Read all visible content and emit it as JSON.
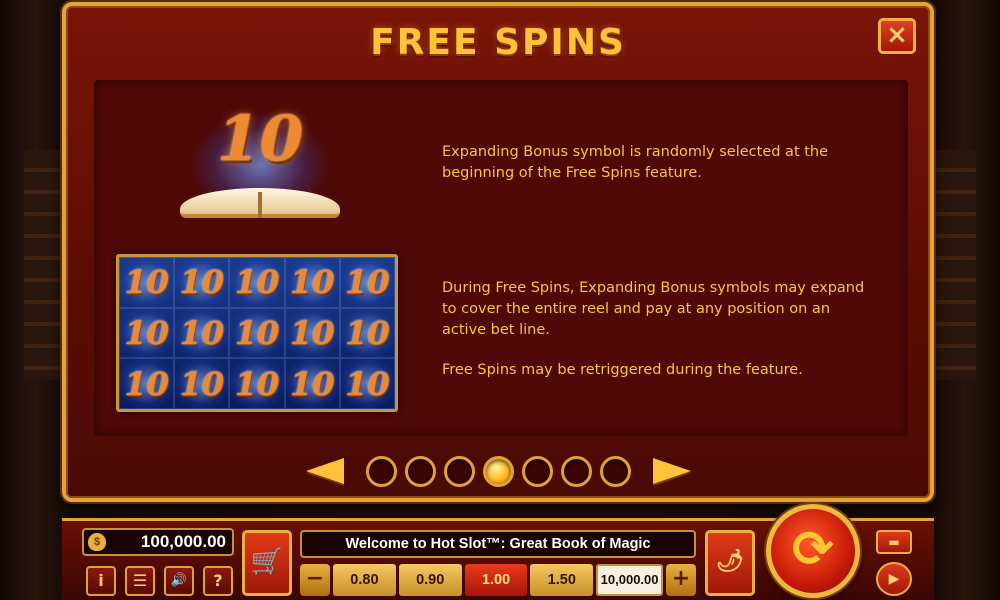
{
  "screen": {
    "title": "FREE SPINS",
    "close_icon": "×"
  },
  "feature": {
    "book_symbol_number": "10",
    "reel_symbol": "10",
    "paragraph1": "Expanding Bonus symbol is randomly selected at the beginning of the Free Spins feature.",
    "paragraph2": "During Free Spins, Expanding Bonus symbols may expand to cover the entire reel and pay at any position on an active bet line.",
    "paragraph3": "Free Spins may be retriggered during the feature."
  },
  "pager": {
    "total_pages": 7,
    "current_page": 4
  },
  "bottom_bar": {
    "balance": "100,000.00",
    "welcome": "Welcome to Hot Slot™: Great Book of Magic",
    "bet_options": [
      "0.80",
      "0.90",
      "1.00",
      "1.50"
    ],
    "selected_bet": "1.00",
    "total_bet": "10,000.00",
    "minus": "−",
    "plus": "+",
    "info": "i",
    "menu": "☰",
    "sound": "🔊",
    "help": "?",
    "cart": "🛒",
    "hot": "🌶",
    "spin": "⟳",
    "autoplay": "▬",
    "play": "▶"
  },
  "colors": {
    "accent_gold": "#ffc23a",
    "panel_red": "#7a1408",
    "active_bet": "#e83a1a"
  }
}
